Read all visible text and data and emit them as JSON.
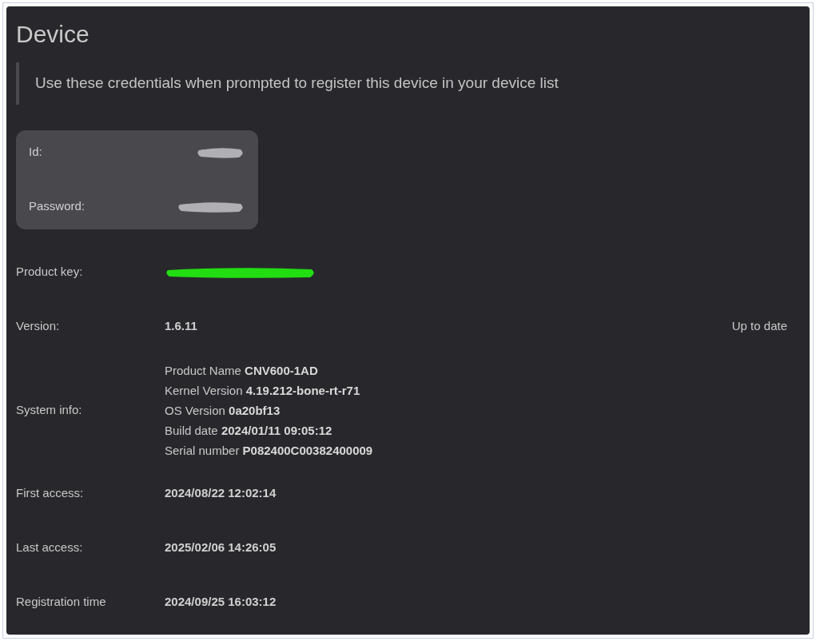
{
  "title": "Device",
  "note": "Use these credentials when prompted to register this device in your device list",
  "credentials": [
    {
      "label": "Id:",
      "redacted": true
    },
    {
      "label": "Password:",
      "redacted": true
    }
  ],
  "rows": [
    {
      "label": "Product key:",
      "kind": "redacted"
    },
    {
      "label": "Version:",
      "kind": "text",
      "value": "1.6.11",
      "status": "Up to date"
    },
    {
      "label": "System info:",
      "kind": "lines",
      "lines": [
        "Product Name **CNV600-1AD**",
        "Kernel Version **4.19.212-bone-rt-r71**",
        "OS Version **0a20bf13**",
        "Build date **2024/01/11 09:05:12**",
        "Serial number **P082400C00382400009**"
      ]
    },
    {
      "label": "First access:",
      "kind": "text",
      "value": "2024/08/22 12:02:14"
    },
    {
      "label": "Last access:",
      "kind": "text",
      "value": "2025/02/06 14:26:05"
    },
    {
      "label": "Registration time",
      "kind": "text",
      "value": "2024/09/25 16:03:12"
    }
  ]
}
